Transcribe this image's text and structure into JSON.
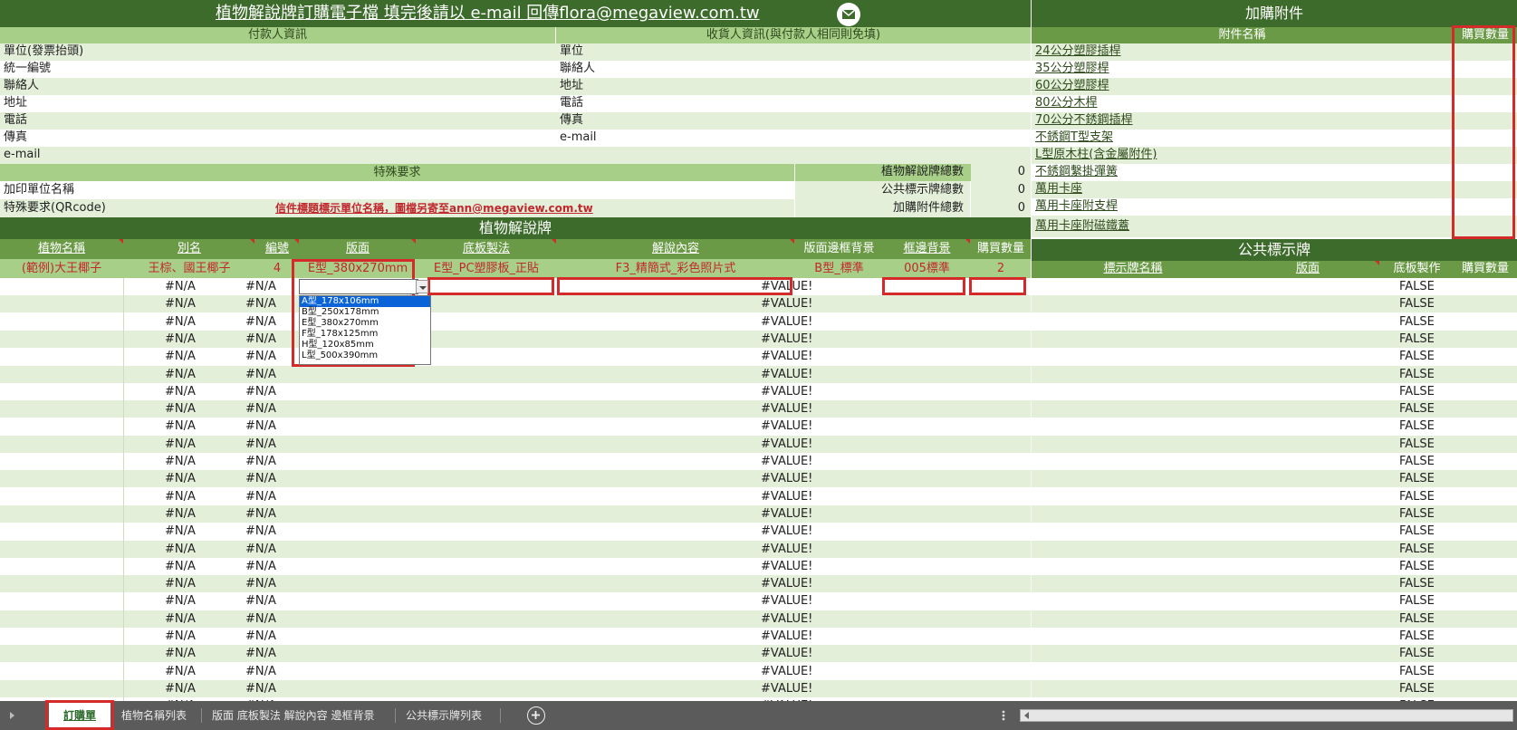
{
  "colors": {
    "dark_green": "#3d6b2b",
    "mid_green": "#6a9a45",
    "light_green": "#a8cf88",
    "pale_green": "#e4efda",
    "highlight_red": "#d42a2a",
    "text_red": "#c0282d",
    "tab_bar": "#5b5b5b"
  },
  "header": {
    "title": "植物解說牌訂購電子檔  填完後請以 e-mail 回傳flora@megaview.com.tw",
    "mail_icon": "envelope-icon"
  },
  "payer": {
    "title": "付款人資訊",
    "fields": [
      "單位(發票抬頭)",
      "統一編號",
      "聯絡人",
      "地址",
      "電話",
      "傳真",
      "e-mail"
    ]
  },
  "receiver": {
    "title": "收貨人資訊(與付款人相同則免填)",
    "fields": [
      "單位",
      "聯絡人",
      "地址",
      "電話",
      "傳真",
      "e-mail"
    ]
  },
  "special": {
    "title": "特殊要求",
    "row1_label": "加印單位名稱",
    "row2_label": "特殊要求(QRcode)",
    "row2_note": "信件標題標示單位名稱，圖檔另寄至ann@megaview.com.tw"
  },
  "totals": [
    {
      "label": "植物解說牌總數",
      "value": "0"
    },
    {
      "label": "公共標示牌總數",
      "value": "0"
    },
    {
      "label": "加購附件總數",
      "value": "0"
    }
  ],
  "accessories": {
    "title": "加購附件",
    "col_name": "附件名稱",
    "col_qty": "購買數量",
    "items": [
      "24公分塑膠插桿",
      "35公分塑膠桿",
      "60公分塑膠桿",
      "80公分木桿",
      "70公分不銹鋼插桿",
      "不銹鋼T型支架",
      "L型原木柱(含金屬附件)",
      "不銹鋼繫掛彈簧",
      "萬用卡座",
      "萬用卡座附支桿",
      "萬用卡座附磁鐵蓋"
    ]
  },
  "plant_signs": {
    "title": "植物解說牌",
    "columns": [
      "植物名稱",
      "別名",
      "編號",
      "版面",
      "底板製法",
      "解說內容",
      "版面邊框背景",
      "框邊背景",
      "購買數量"
    ],
    "example": [
      "(範例)大王椰子",
      "王棕、國王椰子",
      "4",
      "E型_380x270mm",
      "E型_PC塑膠板_正貼",
      "F3_精簡式_彩色照片式",
      "B型_標準",
      "005標準",
      "2"
    ],
    "na_value": "#N/A",
    "value_error": "#VALUE!"
  },
  "public_signs": {
    "title": "公共標示牌",
    "columns": [
      "標示牌名稱",
      "版面",
      "底板製作",
      "購買數量"
    ],
    "false_value": "FALSE"
  },
  "dropdown": {
    "options": [
      "A型_178x106mm",
      "B型_250x178mm",
      "E型_380x270mm",
      "F型_178x125mm",
      "H型_120x85mm",
      "L型_500x390mm"
    ],
    "selected": "A型_178x106mm"
  },
  "tabs": {
    "items": [
      "訂購單",
      "植物名稱列表",
      "版面 底板製法 解說內容 邊框背景",
      "公共標示牌列表"
    ],
    "active": "訂購單"
  },
  "icons": {
    "prev": "scroll-left-icon",
    "add": "add-sheet-icon",
    "more": "more-icon",
    "hscroll": "horizontal-scrollbar"
  }
}
